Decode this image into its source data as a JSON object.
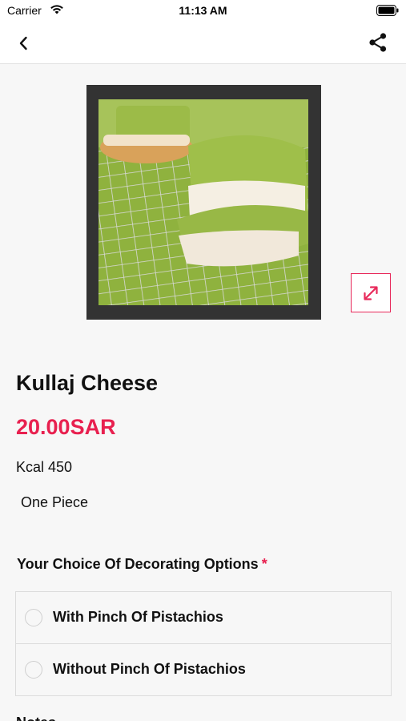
{
  "status_bar": {
    "carrier": "Carrier",
    "time": "11:13 AM"
  },
  "nav": {
    "back_icon": "chevron-left-icon",
    "share_icon": "share-icon"
  },
  "product": {
    "name": "Kullaj Cheese",
    "price": "20.00SAR",
    "kcal": "Kcal 450",
    "unit": "One Piece",
    "expand_icon": "expand-arrows-icon"
  },
  "options": {
    "title": "Your Choice Of Decorating Options",
    "required_mark": "*",
    "items": [
      {
        "label": "With Pinch Of Pistachios",
        "selected": false
      },
      {
        "label": "Without Pinch Of Pistachios",
        "selected": false
      }
    ]
  },
  "notes": {
    "label": "Notes"
  },
  "colors": {
    "accent": "#e8204f",
    "background": "#f7f7f7",
    "image_frame": "#333333"
  }
}
